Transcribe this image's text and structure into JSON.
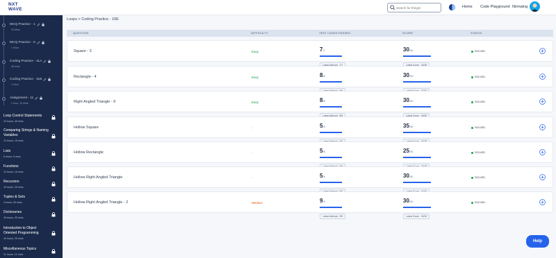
{
  "header": {
    "logo_line1": "NXT",
    "logo_line2": "WAVE",
    "search_placeholder": "Search for things!",
    "nav_home": "Home",
    "nav_code_playground": "Code Playground",
    "user_name": "Nirmalraj"
  },
  "sidebar": {
    "sub_items": [
      {
        "title": "MCQ Practice - 1",
        "meta": "20 Mins"
      },
      {
        "title": "MCQ Practice - 5",
        "meta": "1 Hour"
      },
      {
        "title": "Coding Practice - 11A",
        "meta": "48 mins"
      },
      {
        "title": "Coding Practice - 11B",
        "meta": "1 Hour"
      },
      {
        "title": "Assignment - 11",
        "meta": "1 hour, 15 mins"
      }
    ],
    "sections": [
      {
        "title": "Loop Control Statements",
        "meta": "24 hours, 45 mins"
      },
      {
        "title": "Comparing Strings & Naming Variables",
        "meta": "13 hours, 15 mins"
      },
      {
        "title": "Lists",
        "meta": "6 hours, 5 mins"
      },
      {
        "title": "Functions",
        "meta": "10 hours, 15 mins"
      },
      {
        "title": "Recursion",
        "meta": "10 hours, 25 mins"
      },
      {
        "title": "Tuples & Sets",
        "meta": "4 hours, 30 mins"
      },
      {
        "title": "Dictionaries",
        "meta": "18 hours, 30 mins"
      },
      {
        "title": "Introduction to Object Oriented Programming",
        "meta": "10 hours, 25 mins"
      },
      {
        "title": "Miscellaneous Topics",
        "meta": "11 hours, 10 mins"
      }
    ]
  },
  "breadcrumb": "Loops > Coding Practice - 10E",
  "table": {
    "headers": {
      "question": "QUESTION",
      "difficulty": "DIFFICULTY",
      "test_cases": "TEST CASES PASSED",
      "score": "SCORE",
      "status": "STATUS"
    },
    "rows": [
      {
        "question": "Square - 3",
        "difficulty": "Easy",
        "tc_passed": "7",
        "tc_total": "/7",
        "tc_latest": "Latest Attempt : 7/7",
        "score": "30",
        "score_total": "/30",
        "score_latest": "Latest Score : 30/30",
        "status": "SOLVED"
      },
      {
        "question": "Rectangle - 4",
        "difficulty": "Easy",
        "tc_passed": "8",
        "tc_total": "/8",
        "tc_latest": "Latest Attempt : 8/8",
        "score": "30",
        "score_total": "/30",
        "score_latest": "Latest Score : 30/30",
        "status": "SOLVED"
      },
      {
        "question": "Right Angled Triangle - 9",
        "difficulty": "Easy",
        "tc_passed": "8",
        "tc_total": "/8",
        "tc_latest": "Latest Attempt : 8/8",
        "score": "30",
        "score_total": "/30",
        "score_latest": "Latest Score : 30/30",
        "status": "SOLVED"
      },
      {
        "question": "Hollow Square",
        "difficulty": "-",
        "tc_passed": "5",
        "tc_total": "/5",
        "tc_latest": "Latest Attempt : 5/5",
        "score": "35",
        "score_total": "/35",
        "score_latest": "Latest Score : 35/35",
        "status": "SOLVED"
      },
      {
        "question": "Hollow Rectangle",
        "difficulty": "-",
        "tc_passed": "5",
        "tc_total": "/5",
        "tc_latest": "Latest Attempt : 5/5",
        "score": "25",
        "score_total": "/25",
        "score_latest": "Latest Score : 25/25",
        "status": "SOLVED"
      },
      {
        "question": "Hollow Right Angled Triangle",
        "difficulty": "-",
        "tc_passed": "5",
        "tc_total": "/5",
        "tc_latest": "Latest Attempt : 5/5",
        "score": "30",
        "score_total": "/30",
        "score_latest": "Latest Score : 30/30",
        "status": "SOLVED"
      },
      {
        "question": "Hollow Right Angled Triangle - 2",
        "difficulty": "Medium",
        "tc_passed": "9",
        "tc_total": "/9",
        "tc_latest": "Latest Attempt : 9/9",
        "score": "30",
        "score_total": "/30",
        "score_latest": "Latest Score : 30/30",
        "status": "SOLVED"
      }
    ]
  },
  "colors": {
    "easy": "#16a34a",
    "medium": "#ea580c",
    "neutral": "#64748b",
    "accent": "#2563eb",
    "sidebar": "#1b2a4a"
  },
  "help_label": "Help"
}
